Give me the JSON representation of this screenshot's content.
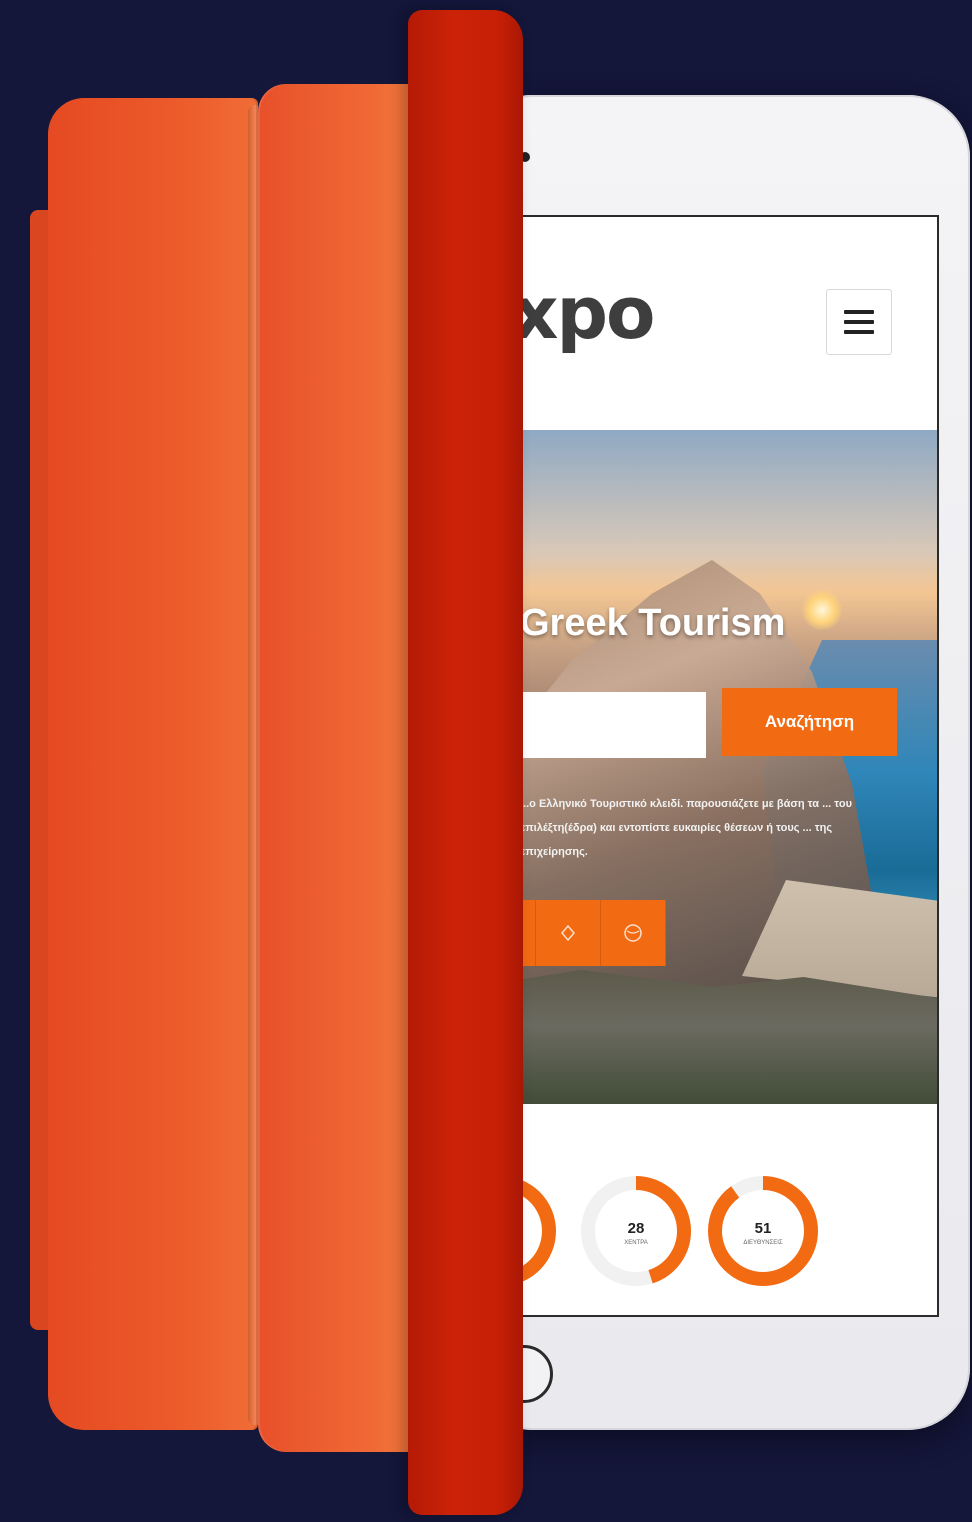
{
  "site": {
    "logo_text": "xpo",
    "menu_label": "menu"
  },
  "hero": {
    "title": "Greek Tourism",
    "search_placeholder": "",
    "search_button_label": "Αναζήτηση",
    "description": "...ο Ελληνικό Τουριστικό κλειδί. παρουσιάζετε με βάση τα ... του επιλέξτη(έδρα) και εντοπίστε ευκαιρίες θέσεων ή τους ... της επιχείρησης."
  },
  "quick_icons": [
    {
      "icon": "compass-icon"
    },
    {
      "icon": "location-pin-icon"
    },
    {
      "icon": "globe-icon"
    }
  ],
  "stats": [
    {
      "value": "",
      "label": "",
      "progress": 0.8
    },
    {
      "value": "28",
      "label": "ΧΕΝΤΡΑ",
      "progress": 0.45
    },
    {
      "value": "51",
      "label": "ΔΙΕΥΘΥΝΣΕΙΣ",
      "progress": 0.9
    }
  ],
  "colors": {
    "background": "#14163a",
    "accent": "#f26a12",
    "case_orange": "#ec5a2a",
    "case_red": "#c51f06"
  }
}
